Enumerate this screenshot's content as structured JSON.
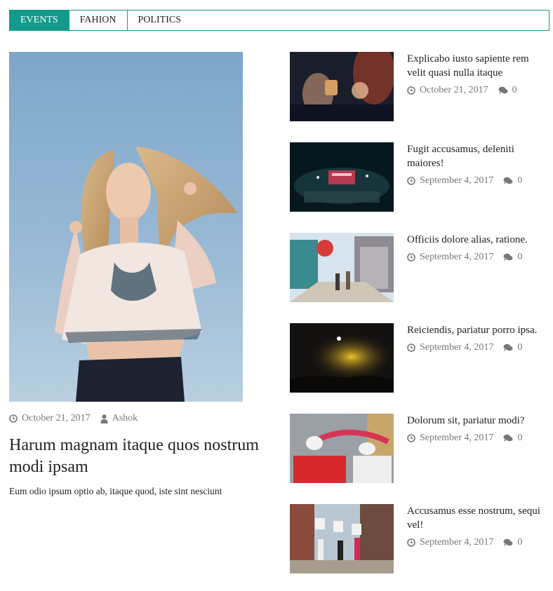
{
  "tabs": [
    {
      "label": "EVENTS",
      "active": true
    },
    {
      "label": "FAHION",
      "active": false
    },
    {
      "label": "POLITICS",
      "active": false
    }
  ],
  "featured": {
    "date": "October 21, 2017",
    "author": "Ashok",
    "title": "Harum magnam itaque quos nostrum modi ipsam",
    "excerpt": "Eum odio ipsum optio ab, itaque quod, iste sint nesciunt"
  },
  "posts": [
    {
      "title": "Explicabo iusto sapiente rem velit quasi nulla itaque",
      "date": "October 21, 2017",
      "comments": "0"
    },
    {
      "title": "Fugit accusamus, deleniti maiores!",
      "date": "September 4, 2017",
      "comments": "0"
    },
    {
      "title": "Officiis dolore alias, ratione.",
      "date": "September 4, 2017",
      "comments": "0"
    },
    {
      "title": "Reiciendis, pariatur porro ipsa.",
      "date": "September 4, 2017",
      "comments": "0"
    },
    {
      "title": "Dolorum sit, pariatur modi?",
      "date": "September 4, 2017",
      "comments": "0"
    },
    {
      "title": "Accusamus esse nostrum, sequi vel!",
      "date": "September 4, 2017",
      "comments": "0"
    }
  ],
  "colors": {
    "accent": "#119a8c",
    "meta": "#777777"
  }
}
